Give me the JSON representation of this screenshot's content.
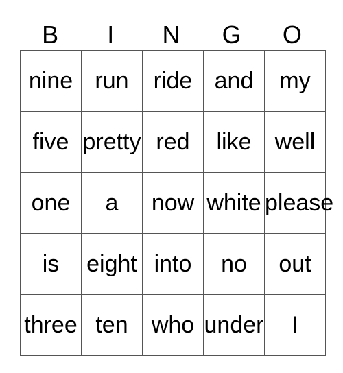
{
  "header": [
    "B",
    "I",
    "N",
    "G",
    "O"
  ],
  "rows": [
    [
      "nine",
      "run",
      "ride",
      "and",
      "my"
    ],
    [
      "five",
      "pretty",
      "red",
      "like",
      "well"
    ],
    [
      "one",
      "a",
      "now",
      "white",
      "please"
    ],
    [
      "is",
      "eight",
      "into",
      "no",
      "out"
    ],
    [
      "three",
      "ten",
      "who",
      "under",
      "I"
    ]
  ]
}
